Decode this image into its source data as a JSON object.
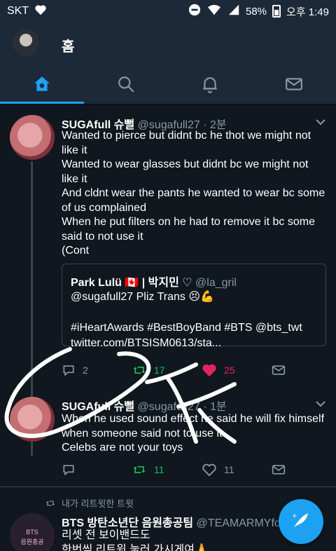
{
  "status_bar": {
    "carrier": "SKT",
    "battery": "58%",
    "time": "오후 1:49"
  },
  "header": {
    "title": "홈"
  },
  "tabs": [
    {
      "icon": "home-icon",
      "active": true
    },
    {
      "icon": "search-icon",
      "active": false
    },
    {
      "icon": "bell-icon",
      "active": false
    },
    {
      "icon": "mail-icon",
      "active": false
    }
  ],
  "tweets": [
    {
      "display_name": "SUGAfull 슈뻘",
      "handle_time": "@sugafull27 · 2분",
      "lines": [
        "Wanted to pierce but didnt bc he thot we might not like it",
        "Wanted to wear glasses but didnt bc we might not like it",
        "And cldnt wear the pants he wanted to wear bc some of us complained",
        "When he put filters on he had to remove it bc some said to not use it",
        "(Cont"
      ],
      "quote": {
        "name": "Park Lulü 🇨🇦 | 박지민 ♡",
        "handle": "@la_gril",
        "line1": "@sugafull27 Pliz Trans 😣💪",
        "line2": "#iHeartAwards #BestBoyBand #BTS @bts_twt twitter.com/BTSISM0613/sta..."
      },
      "replies": "2",
      "retweets": "17",
      "likes": "25"
    },
    {
      "display_name": "SUGAfull 슈뻘",
      "handle_time": "@sugafull27 · 1분",
      "lines": [
        "When he used sound effect he said he will fix himself when someone said not to use it.",
        "Celebs are not your toys"
      ],
      "replies": "",
      "retweets": "11",
      "likes": "11"
    }
  ],
  "retweet_note": "내가 리트윗한 트윗",
  "third_tweet": {
    "display_name": "BTS 방탄소년단 음원총공팀",
    "handle": "@TEAMARMYfor...",
    "avatar_text_1": "BTS",
    "avatar_text_2": "음원총공",
    "line1": "리셋 전 보이밴드도",
    "line2": "한번씩 리트윗 눌러 가시게여🙏"
  },
  "colors": {
    "background": "#10171e",
    "header": "#1c2938",
    "accent": "#1da1f2",
    "retweet": "#17bf63",
    "like": "#e0245e",
    "muted": "#8899a6"
  }
}
